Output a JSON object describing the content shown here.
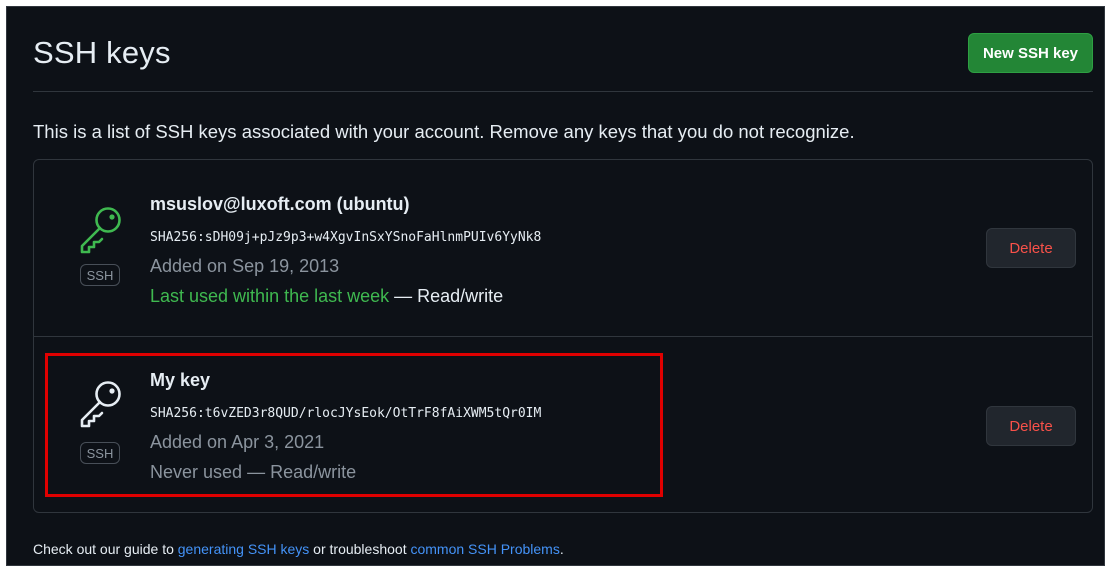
{
  "header": {
    "title": "SSH keys",
    "new_key_label": "New SSH key"
  },
  "intro": "This is a list of SSH keys associated with your account. Remove any keys that you do not recognize.",
  "keys": [
    {
      "title": "msuslov@luxoft.com (ubuntu)",
      "fingerprint": "SHA256:sDH09j+pJz9p3+w4XgvInSxYSnoFaHlnmPUIv6YyNk8",
      "added": "Added on Sep 19, 2013",
      "usage_status": "Last used within the last week",
      "usage_suffix": " — Read/write",
      "badge": "SSH",
      "delete_label": "Delete",
      "icon": "key-icon",
      "icon_color": "#3fb950"
    },
    {
      "title": "My key",
      "fingerprint": "SHA256:t6vZED3r8QUD/rlocJYsEok/OtTrF8fAiXWM5tQr0IM",
      "added": "Added on Apr 3, 2021",
      "usage_status": "Never used",
      "usage_suffix": " — Read/write",
      "badge": "SSH",
      "delete_label": "Delete",
      "icon": "key-icon",
      "icon_color": "#e6edf3"
    }
  ],
  "footer": {
    "prefix": "Check out our guide to ",
    "link1": "generating SSH keys",
    "middle": " or troubleshoot ",
    "link2": "common SSH Problems",
    "suffix": "."
  },
  "colors": {
    "background": "#0d1117",
    "accent_button": "#238636",
    "danger": "#f85149",
    "link": "#4493f8",
    "highlight": "#e00000"
  }
}
